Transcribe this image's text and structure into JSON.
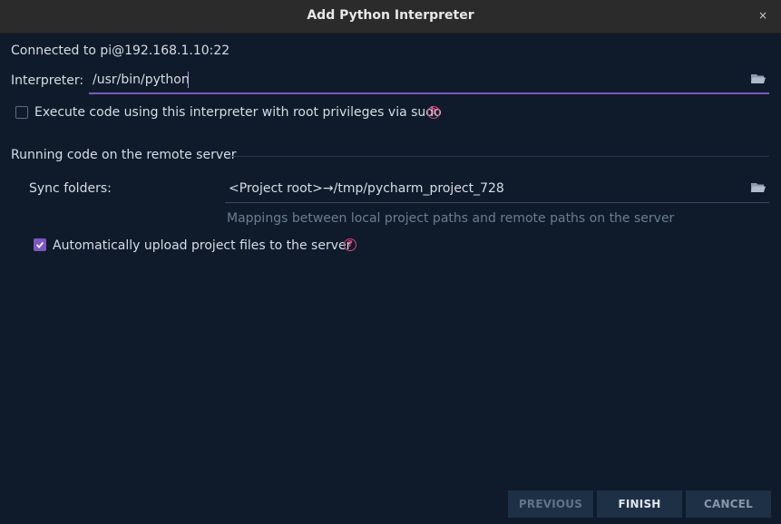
{
  "window": {
    "title": "Add Python Interpreter",
    "close_glyph": "×"
  },
  "connection": {
    "label": "Connected to pi@192.168.1.10:22"
  },
  "interpreter": {
    "label": "Interpreter:",
    "value": "/usr/bin/python"
  },
  "sudo": {
    "label": "Execute code using this interpreter with root privileges via sudo",
    "checked": false,
    "help_glyph": "?"
  },
  "remote_section": {
    "heading": "Running code on the remote server",
    "sync_label": "Sync folders:",
    "sync_value": "<Project root>→/tmp/pycharm_project_728",
    "sync_hint": "Mappings between local project paths and remote paths on the server",
    "auto_upload_label": "Automatically upload project files to the server",
    "auto_upload_checked": true,
    "help_glyph": "?"
  },
  "buttons": {
    "previous": "PREVIOUS",
    "finish": "FINISH",
    "cancel": "CANCEL"
  },
  "colors": {
    "background": "#0f1b2a",
    "titlebar": "#2b2b2b",
    "accent": "#7e57c2",
    "help": "#e0407a",
    "button_bg": "#1d3045"
  }
}
